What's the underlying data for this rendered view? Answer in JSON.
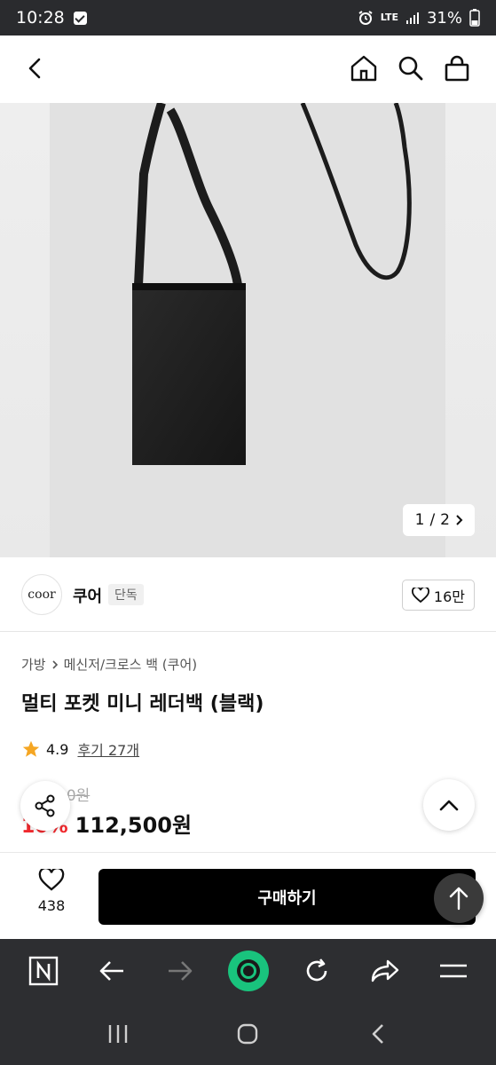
{
  "status_bar": {
    "time": "10:28",
    "network": "LTE",
    "battery": "31%"
  },
  "header": {
    "back": "back",
    "home": "home",
    "search": "search",
    "cart": "shopping-bag"
  },
  "gallery": {
    "current": "1",
    "separator": "/",
    "total": "2"
  },
  "brand": {
    "logo_text": "coor",
    "name": "쿠어",
    "tag": "단독",
    "likes": "16만"
  },
  "breadcrumb": {
    "category": "가방",
    "subcategory": "메신저/크로스 백 (쿠어)"
  },
  "product": {
    "title": "멀티 포켓 미니 레더백 (블랙)",
    "rating": "4.9",
    "reviews": "후기 27개",
    "original_price_visible": "00원",
    "discount_visible": "10%",
    "price": "112,500원"
  },
  "purchase_bar": {
    "wish_count": "438",
    "buy_label": "구매하기"
  },
  "colors": {
    "accent_red": "#f0292e",
    "buy_button": "#000000",
    "star": "#f5a623",
    "browser_green": "#19c37d"
  }
}
